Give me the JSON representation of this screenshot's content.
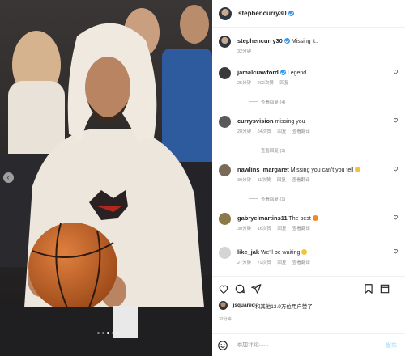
{
  "post": {
    "author": "stephencurry30",
    "caption": "Missing it..",
    "caption_time": "32分钟"
  },
  "comments": [
    {
      "user": "jamalcrawford",
      "verified": true,
      "text": "Legend",
      "time": "25分钟",
      "likes": "202次赞",
      "reply": "回复",
      "translate": "",
      "replies": "查看回复 (4)",
      "avatar_color": "#3a3a3a"
    },
    {
      "user": "currysvision",
      "verified": false,
      "text": "missing you",
      "time": "28分钟",
      "likes": "54次赞",
      "reply": "回复",
      "translate": "查看翻译",
      "replies": "查看回复 (3)",
      "avatar_color": "#5a5a5a"
    },
    {
      "user": "nawlins_margaret",
      "verified": false,
      "text": "Missing you can't you tell",
      "emoji": true,
      "time": "30分钟",
      "likes": "11次赞",
      "reply": "回复",
      "translate": "查看翻译",
      "replies": "查看回复 (1)",
      "avatar_color": "#7a6a5a"
    },
    {
      "user": "gabryelmartins11",
      "verified": false,
      "text": "The best",
      "emoji": true,
      "time": "30分钟",
      "likes": "16次赞",
      "reply": "回复",
      "translate": "查看翻译",
      "replies": "",
      "avatar_color": "#8a7a4a"
    },
    {
      "user": "like_jak",
      "verified": false,
      "text": "We'll be waiting",
      "emoji": true,
      "time": "27分钟",
      "likes": "79次赞",
      "reply": "回复",
      "translate": "查看翻译",
      "replies": "",
      "avatar_color": "#c8c8c8"
    }
  ],
  "likes_line": {
    "user": "_jsquared",
    "suffix": "和其他13.9万位用户赞了"
  },
  "post_time": "32分钟",
  "add_comment": {
    "placeholder": "添加评论......",
    "post_label": "发布"
  },
  "icons": {
    "like": "heart-icon",
    "comment": "comment-icon",
    "share": "share-icon",
    "save": "bookmark-icon",
    "emoji": "emoji-icon",
    "prev": "chevron-left-icon"
  },
  "colors": {
    "verified": "#3897f0",
    "muted": "#8e8e8e",
    "post_button": "#b2dffc"
  },
  "carousel": {
    "total": 5,
    "active": 3
  }
}
